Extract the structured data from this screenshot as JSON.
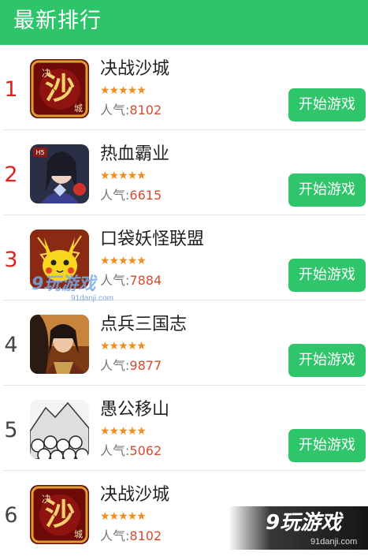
{
  "header": {
    "title": "最新排行"
  },
  "list": {
    "items": [
      {
        "rank": "1",
        "name": "决战沙城",
        "stars": "★★★★★",
        "pop_label": "人气:",
        "pop_value": "8102",
        "button": "开始游戏",
        "icon": "juezhan-shacheng-game-icon"
      },
      {
        "rank": "2",
        "name": "热血霸业",
        "stars": "★★★★★",
        "pop_label": "人气:",
        "pop_value": "6615",
        "button": "开始游戏",
        "icon": "rexue-baye-game-icon"
      },
      {
        "rank": "3",
        "name": "口袋妖怪联盟",
        "stars": "★★★★★",
        "pop_label": "人气:",
        "pop_value": "7884",
        "button": "开始游戏",
        "icon": "pikachu-game-icon"
      },
      {
        "rank": "4",
        "name": "点兵三国志",
        "stars": "★★★★★",
        "pop_label": "人气:",
        "pop_value": "9877",
        "button": "开始游戏",
        "icon": "sanguo-warrior-game-icon"
      },
      {
        "rank": "5",
        "name": "愚公移山",
        "stars": "★★★★★",
        "pop_label": "人气:",
        "pop_value": "5062",
        "button": "开始游戏",
        "icon": "yugong-mountain-game-icon"
      },
      {
        "rank": "6",
        "name": "决战沙城",
        "stars": "★★★★★",
        "pop_label": "人气:",
        "pop_value": "8102",
        "button": "",
        "icon": "juezhan-shacheng-game-icon"
      }
    ]
  },
  "watermark": {
    "logo": "9玩游戏",
    "url": "91danji.com"
  },
  "colors": {
    "header_bg": "#2dc46a",
    "button_bg": "#2ec56b",
    "rank_top": "#e0211d",
    "star": "#f08d1e",
    "pop_value": "#d84a2f"
  }
}
